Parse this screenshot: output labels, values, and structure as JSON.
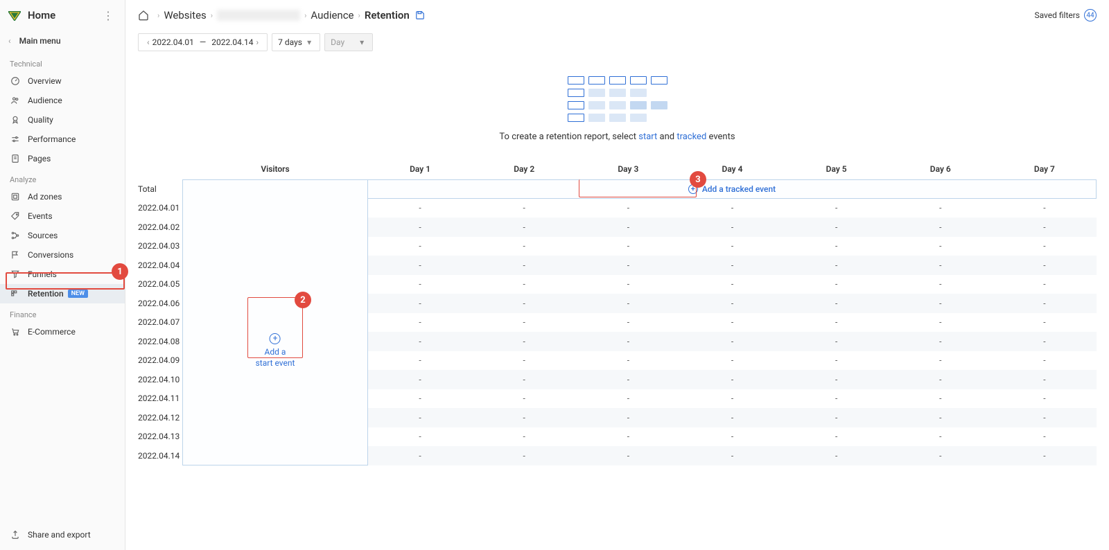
{
  "sidebar": {
    "home": "Home",
    "main_menu": "Main menu",
    "sections": {
      "technical": "Technical",
      "analyze": "Analyze",
      "finance": "Finance"
    },
    "items": {
      "overview": "Overview",
      "audience": "Audience",
      "quality": "Quality",
      "performance": "Performance",
      "pages": "Pages",
      "adzones": "Ad zones",
      "events": "Events",
      "sources": "Sources",
      "conversions": "Conversions",
      "funnels": "Funnels",
      "retention": "Retention",
      "retention_badge": "NEW",
      "ecommerce": "E-Commerce"
    },
    "share": "Share and export"
  },
  "breadcrumb": {
    "websites": "Websites",
    "audience": "Audience",
    "retention": "Retention"
  },
  "header": {
    "saved_filters": "Saved filters",
    "saved_filters_count": "44"
  },
  "controls": {
    "date_from": "2022.04.01",
    "date_sep": "—",
    "date_to": "2022.04.14",
    "range": "7 days",
    "granularity": "Day"
  },
  "hero": {
    "prefix": "To create a retention report, select ",
    "start_link": "start",
    "middle": " and ",
    "tracked_link": "tracked",
    "suffix": " events"
  },
  "table": {
    "headers": {
      "visitors": "Visitors",
      "days": [
        "Day 1",
        "Day 2",
        "Day 3",
        "Day 4",
        "Day 5",
        "Day 6",
        "Day 7"
      ]
    },
    "total_label": "Total",
    "add_tracked": "Add a tracked event",
    "add_start_line1": "Add a",
    "add_start_line2": "start event",
    "rows": [
      "2022.04.01",
      "2022.04.02",
      "2022.04.03",
      "2022.04.04",
      "2022.04.05",
      "2022.04.06",
      "2022.04.07",
      "2022.04.08",
      "2022.04.09",
      "2022.04.10",
      "2022.04.11",
      "2022.04.12",
      "2022.04.13",
      "2022.04.14"
    ],
    "placeholder": "-"
  },
  "callouts": {
    "c1": "1",
    "c2": "2",
    "c3": "3"
  }
}
